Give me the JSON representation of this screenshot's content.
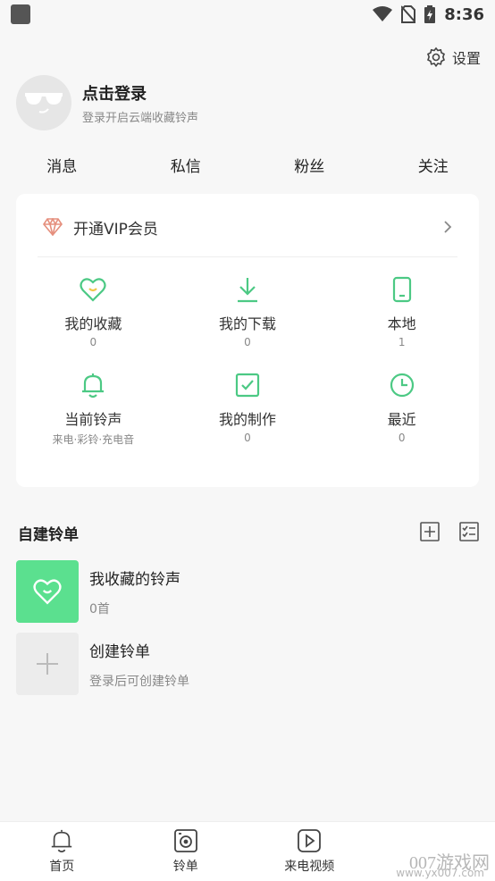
{
  "status": {
    "time": "8:36"
  },
  "settings": {
    "label": "设置"
  },
  "profile": {
    "title": "点击登录",
    "subtitle": "登录开启云端收藏铃声"
  },
  "social": [
    "消息",
    "私信",
    "粉丝",
    "关注"
  ],
  "vip": {
    "label": "开通VIP会员",
    "color": "#e58f7d"
  },
  "grid": [
    {
      "label": "我的收藏",
      "value": "0"
    },
    {
      "label": "我的下载",
      "value": "0"
    },
    {
      "label": "本地",
      "value": "1"
    },
    {
      "label": "当前铃声",
      "value": "来电·彩铃·充电音"
    },
    {
      "label": "我的制作",
      "value": "0"
    },
    {
      "label": "最近",
      "value": "0"
    }
  ],
  "section": {
    "title": "自建铃单"
  },
  "playlists": [
    {
      "title": "我收藏的铃声",
      "subtitle": "0首"
    },
    {
      "title": "创建铃单",
      "subtitle": "登录后可创建铃单"
    }
  ],
  "nav": [
    "首页",
    "铃单",
    "来电视频"
  ],
  "watermark": {
    "main": "007游戏网",
    "sub": "www.yx007.com"
  },
  "colors": {
    "accent": "#4cc984",
    "thumb_green": "#5be08f"
  }
}
